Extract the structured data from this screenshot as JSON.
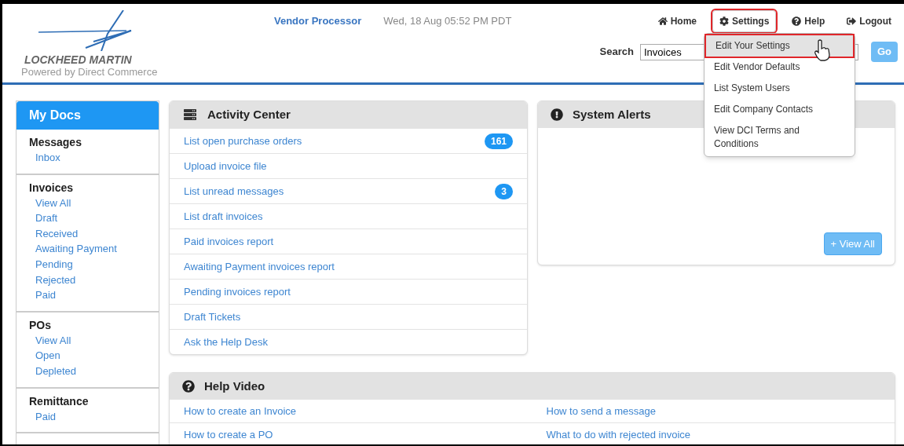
{
  "header": {
    "logo": {
      "name": "LOCKHEED MARTIN",
      "tagline": "Powered by Direct Commerce"
    },
    "role": "Vendor Processor",
    "datetime": "Wed, 18 Aug 05:52 PM PDT",
    "nav": [
      {
        "label": "Home",
        "kind": "home",
        "highlighted": false
      },
      {
        "label": "Settings",
        "kind": "settings",
        "highlighted": true
      },
      {
        "label": "Help",
        "kind": "help",
        "highlighted": false
      },
      {
        "label": "Logout",
        "kind": "logout",
        "highlighted": false
      }
    ],
    "search": {
      "label": "Search",
      "value": "Invoices",
      "button": "Go"
    },
    "settings_menu": [
      {
        "label": "Edit Your Settings",
        "selected": true,
        "highlighted": true
      },
      {
        "label": "Edit Vendor Defaults",
        "selected": false,
        "highlighted": false
      },
      {
        "label": "List System Users",
        "selected": false,
        "highlighted": false
      },
      {
        "label": "Edit Company Contacts",
        "selected": false,
        "highlighted": false
      },
      {
        "label": "View DCI Terms and Conditions",
        "selected": false,
        "highlighted": false
      }
    ]
  },
  "sidebar": {
    "title": "My Docs",
    "sections": [
      {
        "title": "Messages",
        "items": [
          "Inbox"
        ]
      },
      {
        "title": "Invoices",
        "items": [
          "View All",
          "Draft",
          "Received",
          "Awaiting Payment",
          "Pending",
          "Rejected",
          "Paid"
        ]
      },
      {
        "title": "POs",
        "items": [
          "View All",
          "Open",
          "Depleted"
        ]
      },
      {
        "title": "Remittance",
        "items": [
          "Paid"
        ]
      }
    ]
  },
  "activity_center": {
    "title": "Activity Center",
    "items": [
      {
        "label": "List open purchase orders",
        "count": "161"
      },
      {
        "label": "Upload invoice file"
      },
      {
        "label": "List unread messages",
        "count": "3"
      },
      {
        "label": "List draft invoices"
      },
      {
        "label": "Paid invoices report"
      },
      {
        "label": "Awaiting Payment invoices report"
      },
      {
        "label": "Pending invoices report"
      },
      {
        "label": "Draft Tickets"
      },
      {
        "label": "Ask the Help Desk"
      }
    ]
  },
  "system_alerts": {
    "title": "System Alerts",
    "button": "+ View All"
  },
  "help_video": {
    "title": "Help Video",
    "links": [
      "How to create an Invoice",
      "How to send a message",
      "How to create a PO",
      "What to do with rejected invoice"
    ]
  }
}
